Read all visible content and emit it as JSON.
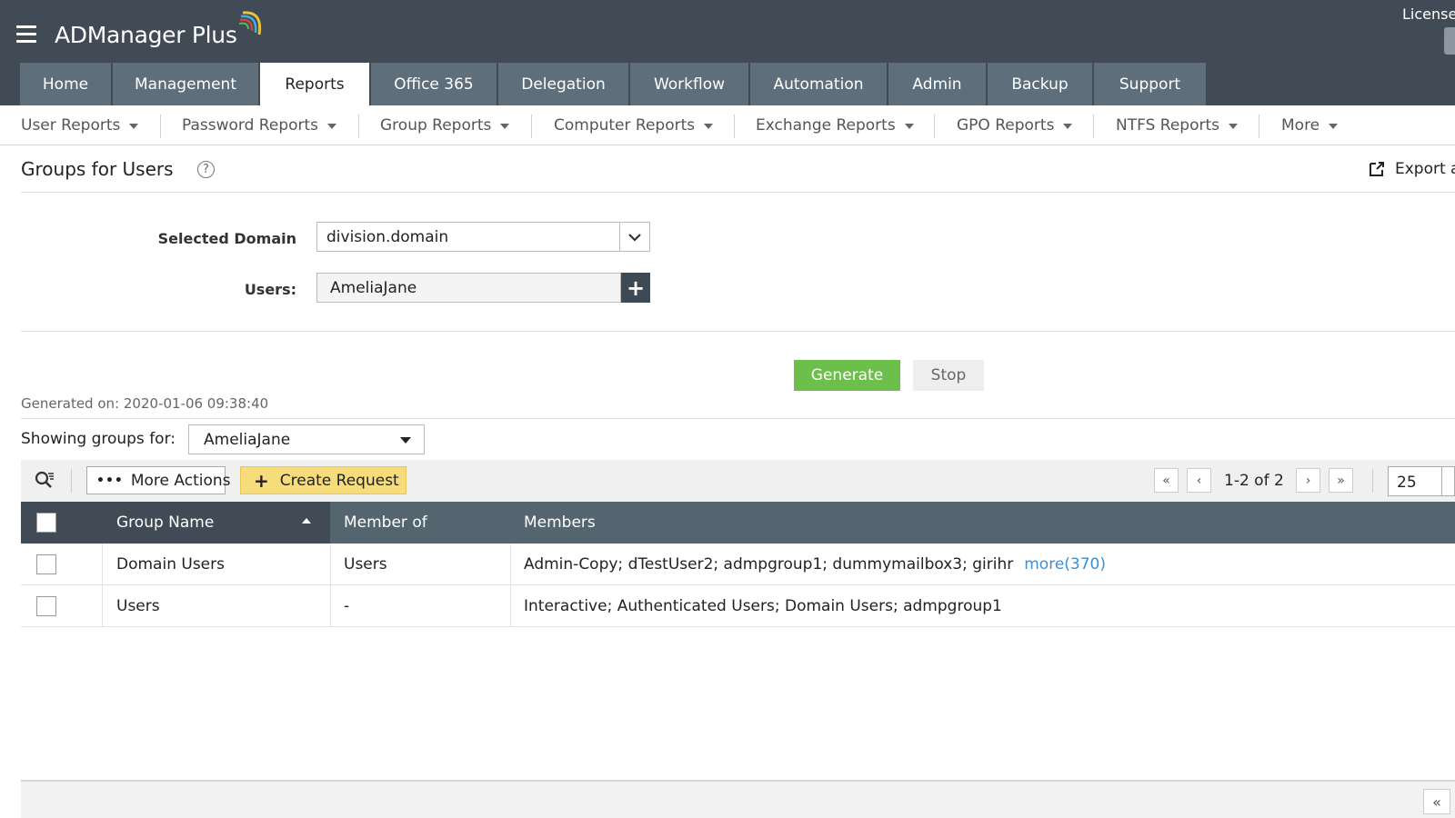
{
  "header": {
    "app_name": "ADManager Plus",
    "license_label": "License",
    "tabs": [
      {
        "label": "Home"
      },
      {
        "label": "Management"
      },
      {
        "label": "Reports"
      },
      {
        "label": "Office 365"
      },
      {
        "label": "Delegation"
      },
      {
        "label": "Workflow"
      },
      {
        "label": "Automation"
      },
      {
        "label": "Admin"
      },
      {
        "label": "Backup"
      },
      {
        "label": "Support"
      }
    ],
    "active_tab": "Reports"
  },
  "subnav": {
    "items": [
      {
        "label": "User Reports"
      },
      {
        "label": "Password Reports"
      },
      {
        "label": "Group Reports"
      },
      {
        "label": "Computer Reports"
      },
      {
        "label": "Exchange Reports"
      },
      {
        "label": "GPO Reports"
      },
      {
        "label": "NTFS Reports"
      },
      {
        "label": "More"
      }
    ]
  },
  "page": {
    "title": "Groups for Users",
    "help_glyph": "?",
    "export_label": "Export a"
  },
  "form": {
    "domain_label": "Selected Domain",
    "domain_value": "division.domain",
    "users_label": "Users:",
    "users_value": "AmeliaJane",
    "add_glyph": "+",
    "generate_label": "Generate",
    "stop_label": "Stop"
  },
  "report": {
    "generated_on": "Generated on: 2020-01-06 09:38:40",
    "showing_label": "Showing groups for:",
    "showing_value": "AmeliaJane"
  },
  "toolbar": {
    "more_actions_dots": "•••",
    "more_actions_label": "More Actions",
    "create_request_glyph": "+",
    "create_request_label": "Create Request",
    "pager_text": "1-2 of 2",
    "page_size": "25",
    "pager_first": "«",
    "pager_prev": "‹",
    "pager_next": "›",
    "pager_last": "»"
  },
  "table": {
    "columns": [
      "Group Name",
      "Member of",
      "Members"
    ],
    "rows": [
      {
        "group_name": "Domain Users",
        "member_of": "Users",
        "members": "Admin-Copy; dTestUser2; admpgroup1; dummymailbox3; girihr",
        "more": "more(370)"
      },
      {
        "group_name": "Users",
        "member_of": "-",
        "members": "Interactive; Authenticated Users; Domain Users; admpgroup1",
        "more": ""
      }
    ]
  },
  "footer": {
    "collapse_glyph": "«"
  },
  "colors": {
    "header_bg": "#404b55",
    "tab_bg": "#5e6f7b",
    "generate_green": "#6cbf4a",
    "create_request_yellow": "#f7dc7c",
    "link_blue": "#3a8fd6"
  }
}
